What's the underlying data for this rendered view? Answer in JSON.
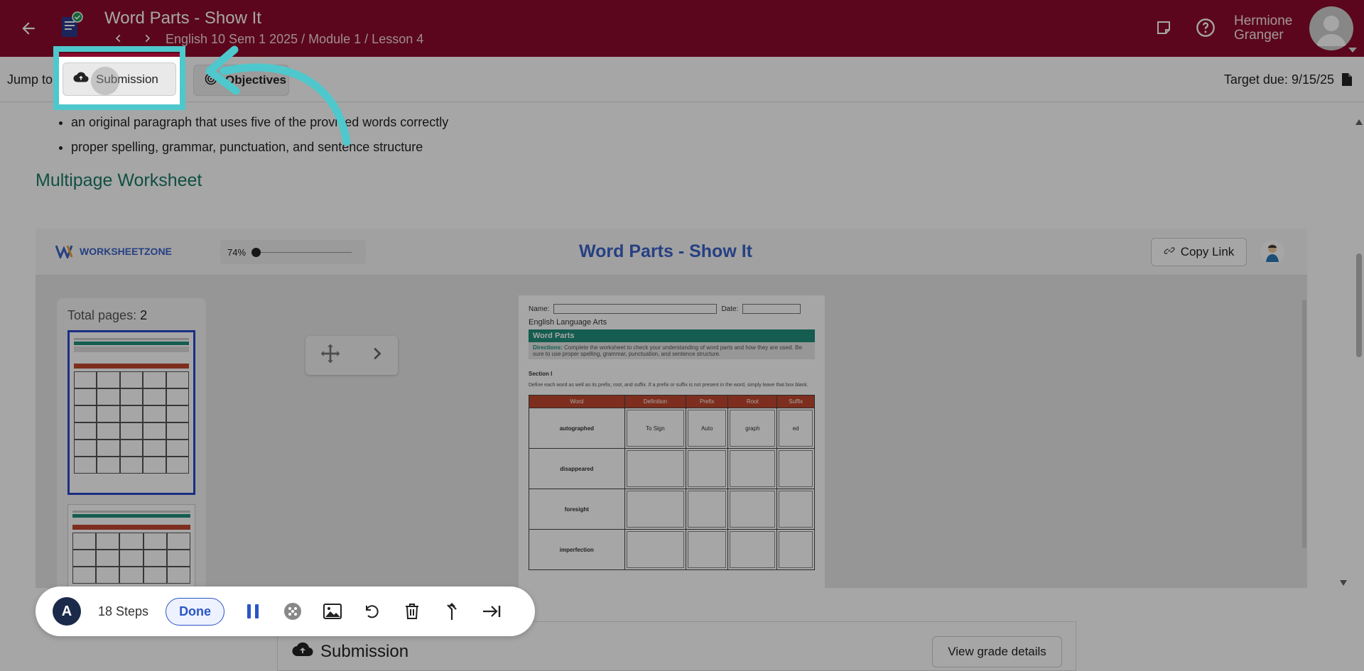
{
  "header": {
    "title": "Word Parts - Show It",
    "breadcrumb": "English 10 Sem 1 2025 / Module 1 / Lesson 4",
    "user_first": "Hermione",
    "user_last": "Granger"
  },
  "jumpbar": {
    "label": "Jump to",
    "submission_label": "Submission",
    "objectives_label": "Objectives",
    "target_due": "Target due: 9/15/25"
  },
  "content": {
    "bullets": [
      "an original paragraph that uses five of the provided words correctly",
      "proper spelling, grammar, punctuation, and sentence structure"
    ],
    "section_title": "Multipage Worksheet"
  },
  "worksheet": {
    "brand": "WORKSHEETZONE",
    "zoom": "74%",
    "zoom_fraction": 0.0,
    "title": "Word Parts - Show It",
    "copy_link": "Copy Link",
    "total_pages_label": "Total pages:",
    "total_pages": "2",
    "paper": {
      "name_label": "Name:",
      "date_label": "Date:",
      "subject": "English Language Arts",
      "band": "Word Parts",
      "directions_label": "Directions:",
      "directions": "Complete the worksheet to check your understanding of word parts and how they are used. Be sure to use proper spelling, grammar, punctuation, and sentence structure.",
      "section": "Section I",
      "instructions": "Define each word as well as its prefix, root, and suffix. If a prefix or suffix is not present in the word, simply leave that box blank.",
      "columns": [
        "Word",
        "Definition",
        "Prefix",
        "Root",
        "Suffix"
      ],
      "rows": [
        {
          "word": "autographed",
          "definition": "To Sign",
          "prefix": "Auto",
          "root": "graph",
          "suffix": "ed"
        },
        {
          "word": "disappeared",
          "definition": "",
          "prefix": "",
          "root": "",
          "suffix": ""
        },
        {
          "word": "foresight",
          "definition": "",
          "prefix": "",
          "root": "",
          "suffix": ""
        },
        {
          "word": "imperfection",
          "definition": "",
          "prefix": "",
          "root": "",
          "suffix": ""
        }
      ]
    }
  },
  "recorder": {
    "logo": "A",
    "steps": "18 Steps",
    "done": "Done"
  },
  "submission_card": {
    "title": "Submission",
    "grade_button": "View grade details"
  },
  "colors": {
    "header": "#8c0a2c",
    "highlight": "#4ec8cc",
    "section_title": "#1a7a65",
    "worksheet_title": "#3b63c9"
  }
}
